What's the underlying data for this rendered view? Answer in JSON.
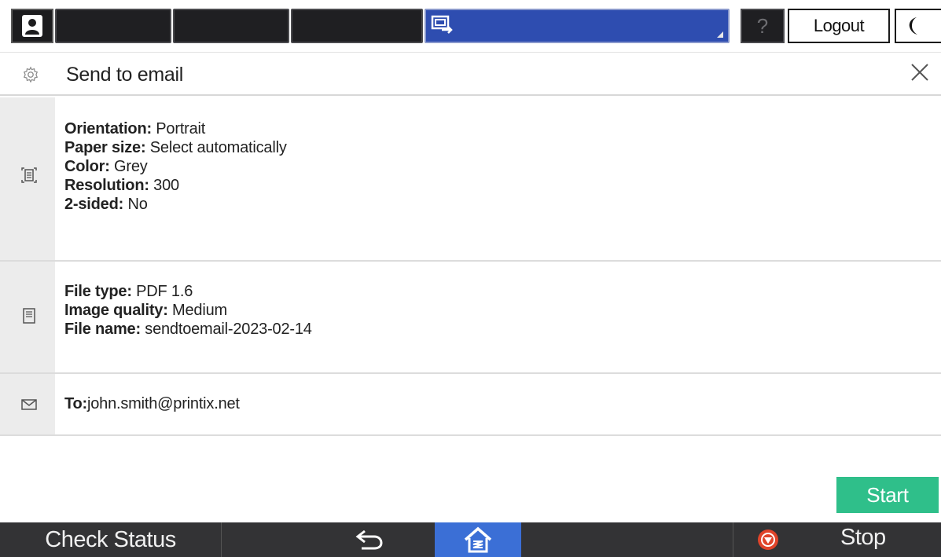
{
  "topbar": {
    "user_icon": "user-icon",
    "screen_icon": "screen-switch-icon",
    "help_label": "?",
    "logout_label": "Logout",
    "moon_icon": "moon-icon"
  },
  "header": {
    "settings_icon": "gear-icon",
    "title": "Send to email",
    "close_icon": "close-icon"
  },
  "scan_settings": {
    "icon": "scan-document-icon",
    "items": [
      {
        "label": "Orientation:",
        "value": "Portrait"
      },
      {
        "label": "Paper size:",
        "value": "Select automatically"
      },
      {
        "label": "Color:",
        "value": "Grey"
      },
      {
        "label": "Resolution:",
        "value": "300"
      },
      {
        "label": "2-sided:",
        "value": "No"
      }
    ]
  },
  "file_settings": {
    "icon": "file-icon",
    "items": [
      {
        "label": "File type:",
        "value": "PDF 1.6"
      },
      {
        "label": "Image quality:",
        "value": "Medium"
      },
      {
        "label": "File name:",
        "value": "sendtoemail-2023-02-14"
      }
    ]
  },
  "recipient": {
    "icon": "envelope-icon",
    "label": "To:",
    "value": "john.smith@printix.net"
  },
  "actions": {
    "start_label": "Start"
  },
  "bottombar": {
    "check_status_label": "Check Status",
    "back_icon": "back-arrow-icon",
    "home_icon": "home-icon",
    "stop_icon": "stop-icon",
    "stop_label": "Stop",
    "colors": {
      "home_active": "#3b6fd6",
      "start": "#2fbf8a",
      "stop": "#e0442a"
    }
  }
}
